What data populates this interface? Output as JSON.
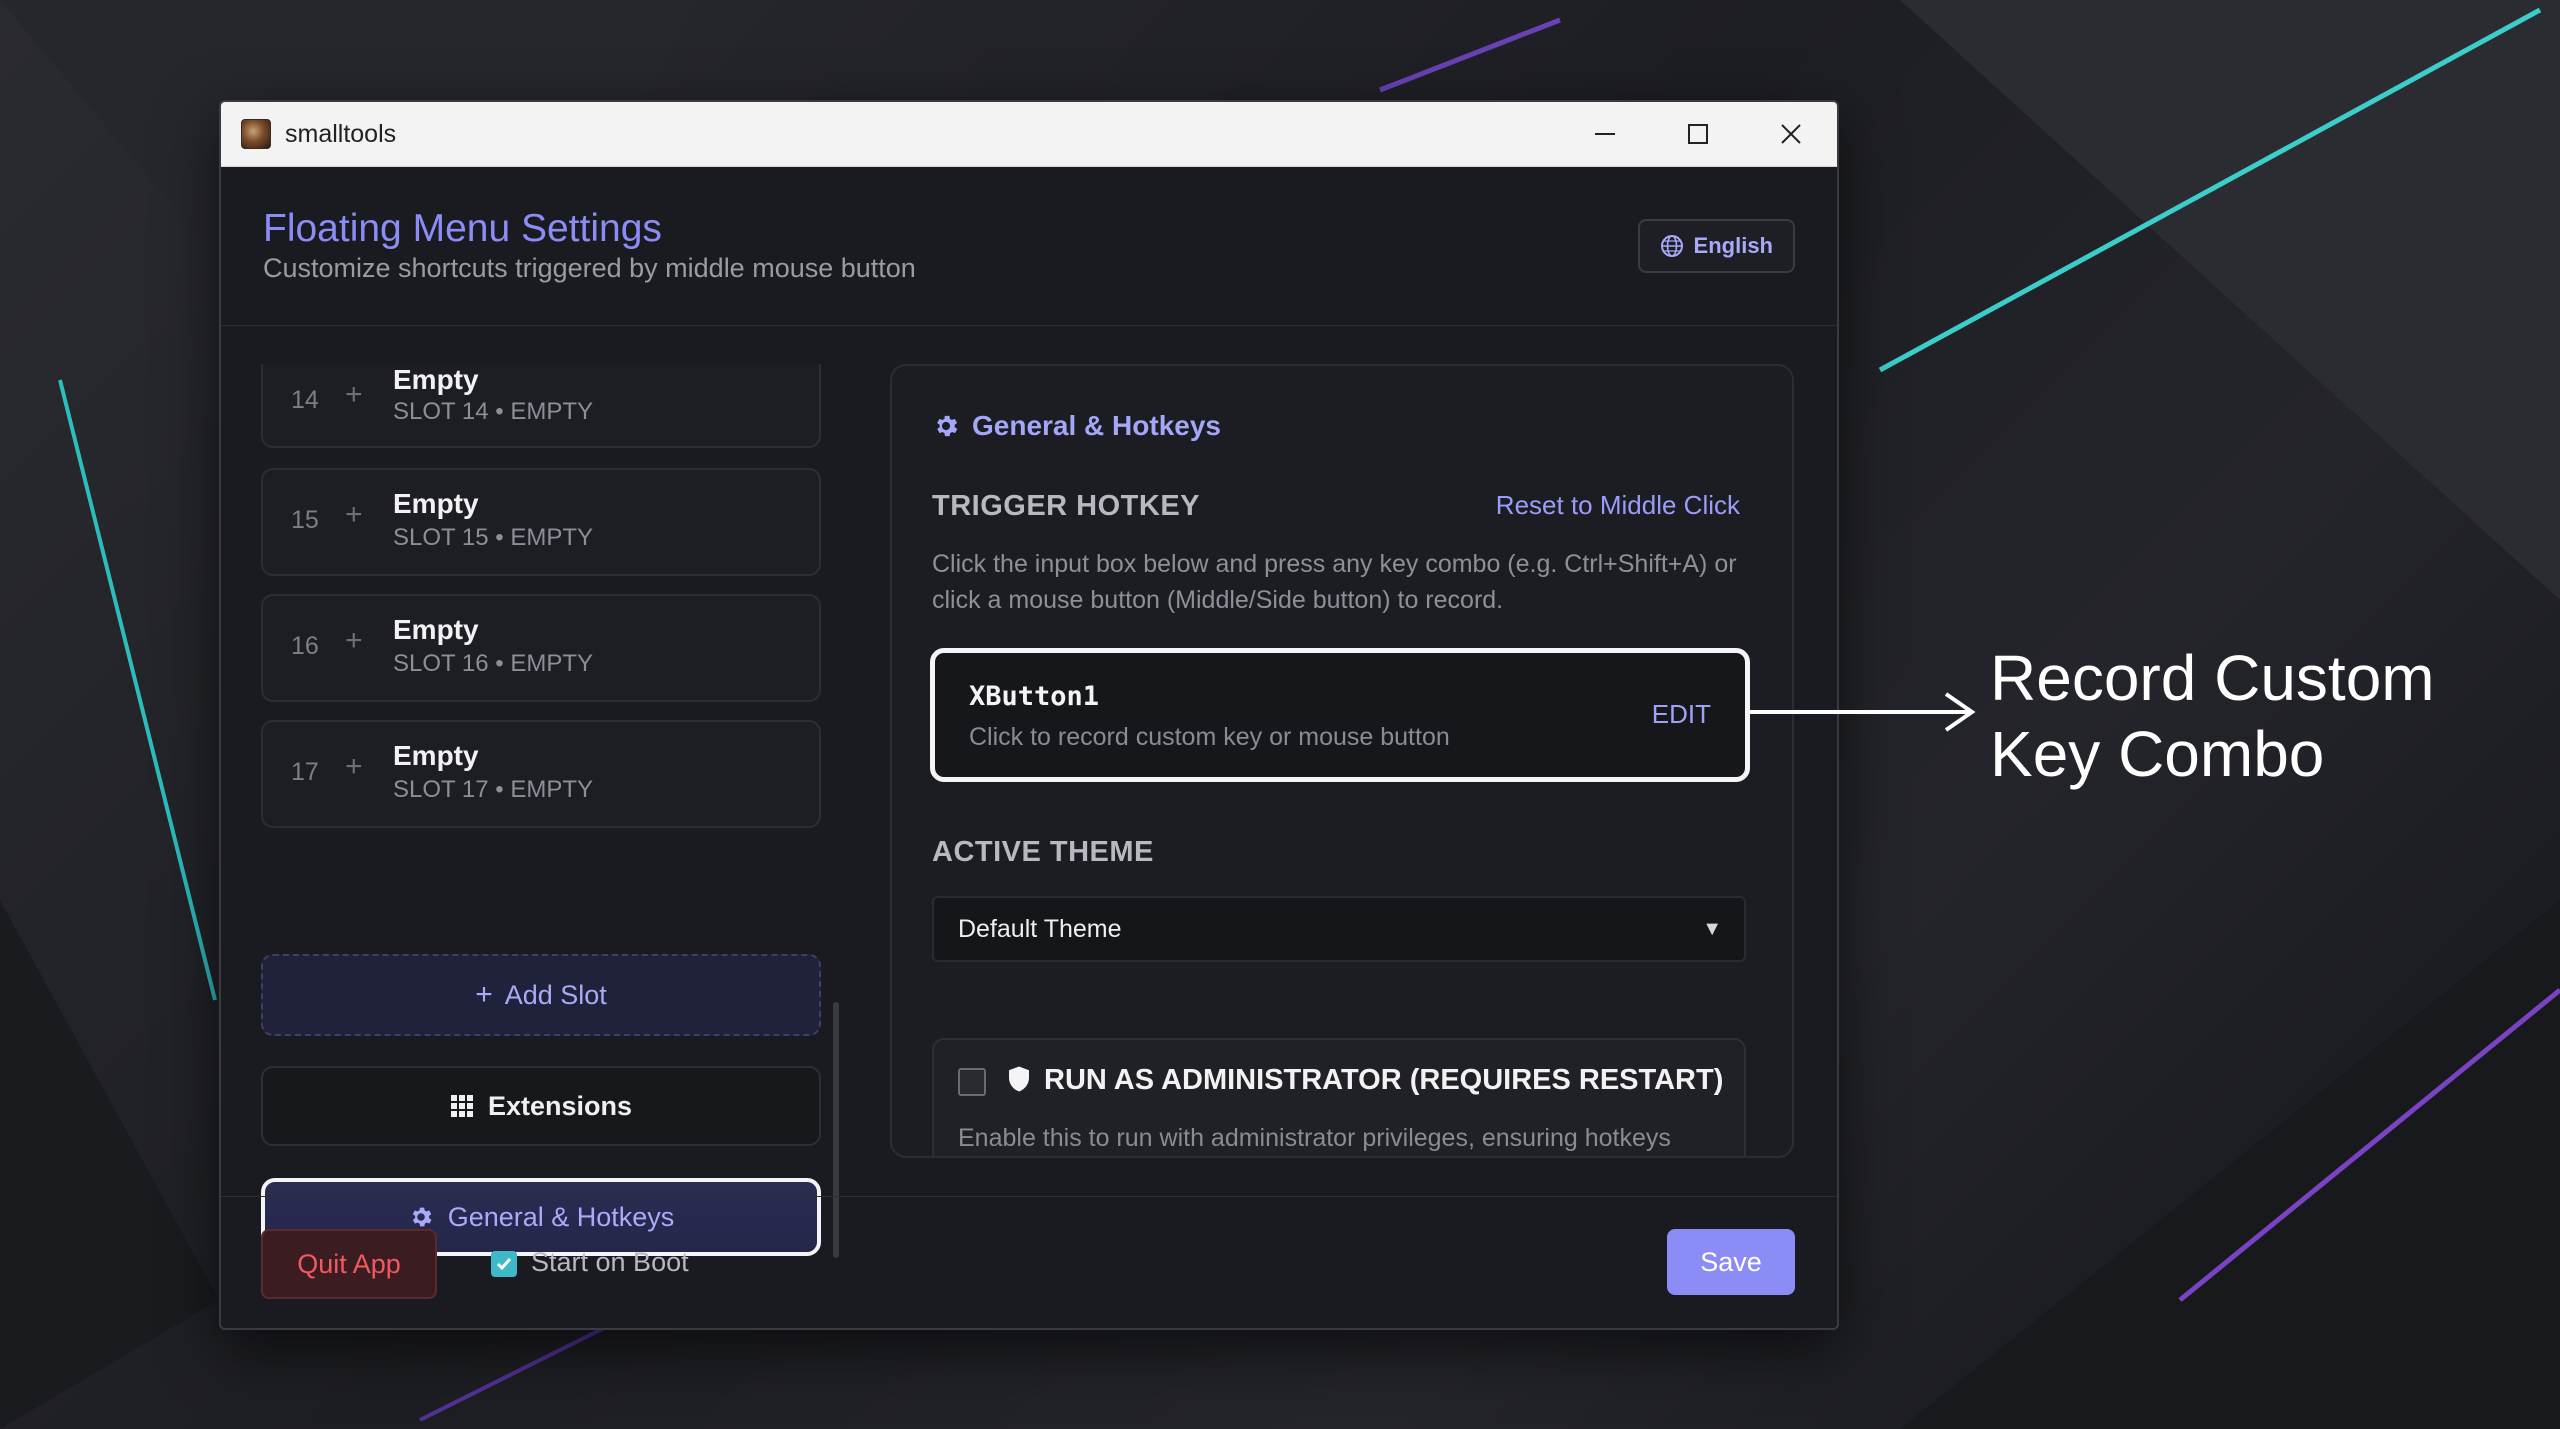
{
  "window": {
    "app_title": "smalltools"
  },
  "header": {
    "title": "Floating Menu Settings",
    "subtitle": "Customize shortcuts triggered by middle mouse button",
    "language": "English"
  },
  "slots": [
    {
      "num": "14",
      "name": "Empty",
      "sub": "SLOT 14 • EMPTY"
    },
    {
      "num": "15",
      "name": "Empty",
      "sub": "SLOT 15 • EMPTY"
    },
    {
      "num": "16",
      "name": "Empty",
      "sub": "SLOT 16 • EMPTY"
    },
    {
      "num": "17",
      "name": "Empty",
      "sub": "SLOT 17 • EMPTY"
    }
  ],
  "sidebar": {
    "add_slot": "Add Slot",
    "extensions": "Extensions",
    "general_hotkeys": "General & Hotkeys"
  },
  "panel": {
    "title": "General & Hotkeys",
    "trigger_label": "TRIGGER HOTKEY",
    "reset_link": "Reset to Middle Click",
    "help_text": "Click the input box below and press any key combo (e.g. Ctrl+Shift+A) or click a mouse button (Middle/Side button) to record.",
    "hotkey_value": "XButton1",
    "hotkey_hint": "Click to record custom key or mouse button",
    "hotkey_edit": "EDIT",
    "theme_label": "ACTIVE THEME",
    "theme_value": "Default Theme",
    "admin_label": "RUN AS ADMINISTRATOR (REQUIRES RESTART)",
    "admin_desc": "Enable this to run with administrator privileges, ensuring hotkeys"
  },
  "footer": {
    "quit": "Quit App",
    "start_on_boot": "Start on Boot",
    "start_on_boot_checked": true,
    "save": "Save"
  },
  "callout": {
    "text": "Record Custom Key Combo"
  },
  "colors": {
    "accent": "#8b8cf5",
    "danger": "#f05a5e",
    "checkbox": "#3fb9c8"
  }
}
